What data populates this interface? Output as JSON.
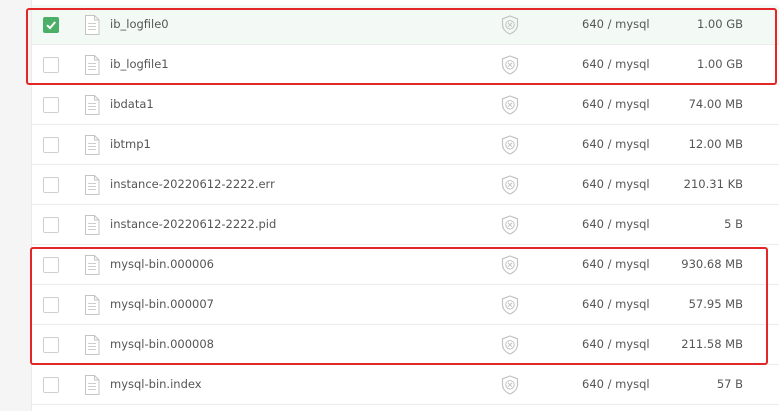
{
  "files": [
    {
      "name": "ib_logfile0",
      "permission": "640 / mysql",
      "size": "1.00 GB",
      "checked": true
    },
    {
      "name": "ib_logfile1",
      "permission": "640 / mysql",
      "size": "1.00 GB",
      "checked": false
    },
    {
      "name": "ibdata1",
      "permission": "640 / mysql",
      "size": "74.00 MB",
      "checked": false
    },
    {
      "name": "ibtmp1",
      "permission": "640 / mysql",
      "size": "12.00 MB",
      "checked": false
    },
    {
      "name": "instance-20220612-2222.err",
      "permission": "640 / mysql",
      "size": "210.31 KB",
      "checked": false
    },
    {
      "name": "instance-20220612-2222.pid",
      "permission": "640 / mysql",
      "size": "5 B",
      "checked": false
    },
    {
      "name": "mysql-bin.000006",
      "permission": "640 / mysql",
      "size": "930.68 MB",
      "checked": false
    },
    {
      "name": "mysql-bin.000007",
      "permission": "640 / mysql",
      "size": "57.95 MB",
      "checked": false
    },
    {
      "name": "mysql-bin.000008",
      "permission": "640 / mysql",
      "size": "211.58 MB",
      "checked": false
    },
    {
      "name": "mysql-bin.index",
      "permission": "640 / mysql",
      "size": "57 B",
      "checked": false
    }
  ],
  "colors": {
    "check_accent": "#4caf68",
    "highlight": "#e32626",
    "icon_gray": "#b5b5b5"
  },
  "icons": {
    "file": "file-icon",
    "protection": "shield-x-icon",
    "checkmark": "checkmark-icon"
  }
}
